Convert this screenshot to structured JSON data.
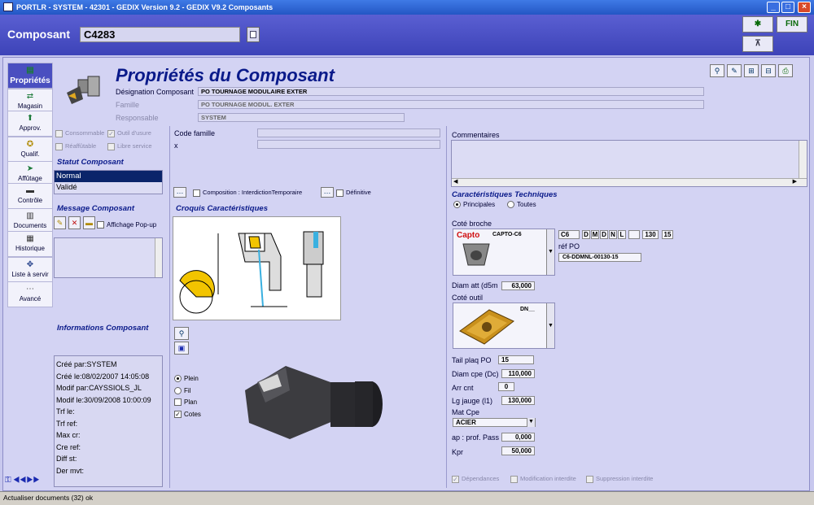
{
  "window": {
    "title": "PORTLR - SYSTEM - 42301 - GEDIX Version 9.2 - GEDIX V9.2 Composants"
  },
  "header": {
    "label": "Composant",
    "code": "C4283",
    "fin_label": "FIN"
  },
  "sidebar": {
    "items": [
      {
        "label": "Propriétés",
        "icon": "properties-icon"
      },
      {
        "label": "Magasin",
        "icon": "store-icon"
      },
      {
        "label": "Approv.",
        "icon": "supply-icon"
      },
      {
        "label": "Qualif.",
        "icon": "qualif-icon"
      },
      {
        "label": "Affûtage",
        "icon": "sharpen-icon"
      },
      {
        "label": "Contrôle",
        "icon": "control-icon"
      },
      {
        "label": "Documents",
        "icon": "documents-icon"
      },
      {
        "label": "Historique",
        "icon": "history-icon"
      },
      {
        "label": "Liste à servir",
        "icon": "list-icon"
      },
      {
        "label": "Avancé",
        "icon": "advanced-icon"
      }
    ]
  },
  "page_title": "Propriétés du Composant",
  "general": {
    "designation_label": "Désignation Composant",
    "designation_value": "PO TOURNAGE MODULAIRE EXTER",
    "famille_label": "Famille",
    "famille_value": "PO TOURNAGE MODUL. EXTER",
    "responsable_label": "Responsable",
    "responsable_value": "SYSTEM"
  },
  "options": {
    "consommable": "Consommable",
    "outil_usure": "Outil d'usure",
    "reaffutable": "Réaffûtable",
    "libre_service": "Libre service"
  },
  "statut": {
    "title": "Statut Composant",
    "items": [
      "Normal",
      "Validé"
    ]
  },
  "message": {
    "title": "Message Composant",
    "popup_label": "Affichage Pop-up"
  },
  "infos": {
    "title": "Informations Composant",
    "lines": [
      "Créé par:SYSTEM",
      "Créé le:08/02/2007 14:05:08",
      "Modif par:CAYSSIOLS_JL",
      "Modif le:30/09/2008 10:00:09",
      "Trf le:",
      "Trf ref:",
      "Max cr:",
      "Cre ref:",
      "Diff st:",
      "Der mvt:"
    ]
  },
  "center": {
    "code_famille_label": "Code famille",
    "x_label": "x",
    "composition_label": "Composition : InterdictionTemporaire",
    "definitive_label": "Définitive",
    "croquis_title": "Croquis Caractéristiques",
    "view_options": [
      "Plein",
      "Fil",
      "Plan",
      "Cotes"
    ]
  },
  "right": {
    "commentaires_label": "Commentaires",
    "tech_title": "Caractéristiques Techniques",
    "radio_principales": "Principales",
    "radio_toutes": "Toutes",
    "cote_broche_label": "Coté broche",
    "capto_brand": "Capto",
    "capto_code": "CAPTO-C6",
    "code_cells": [
      "C6",
      "D",
      "M",
      "D",
      "N",
      "L",
      "",
      "130",
      "15"
    ],
    "ref_po_label": "réf PO",
    "ref_po_value": "C6-DDMNL-00130-15",
    "diam_att_label": "Diam att (d5m",
    "diam_att_value": "63,000",
    "cote_outil_label": "Coté outil",
    "insert_code": "DN__",
    "params": [
      {
        "label": "Tail plaq PO",
        "value": "15"
      },
      {
        "label": "Diam cpe (Dc)",
        "value": "110,000"
      },
      {
        "label": "Arr cnt",
        "value": "0"
      },
      {
        "label": "Lg jauge (l1)",
        "value": "130,000"
      }
    ],
    "mat_cpe_label": "Mat Cpe",
    "mat_cpe_value": "ACIER",
    "ap_label": "ap : prof. Pass",
    "ap_value": "0,000",
    "kpr_label": "Kpr",
    "kpr_value": "50,000",
    "footer_dependances": "Dépendances",
    "footer_modif": "Modification interdite",
    "footer_suppr": "Suppression interdite"
  },
  "status": {
    "text": "Actualiser documents (32) ok"
  }
}
